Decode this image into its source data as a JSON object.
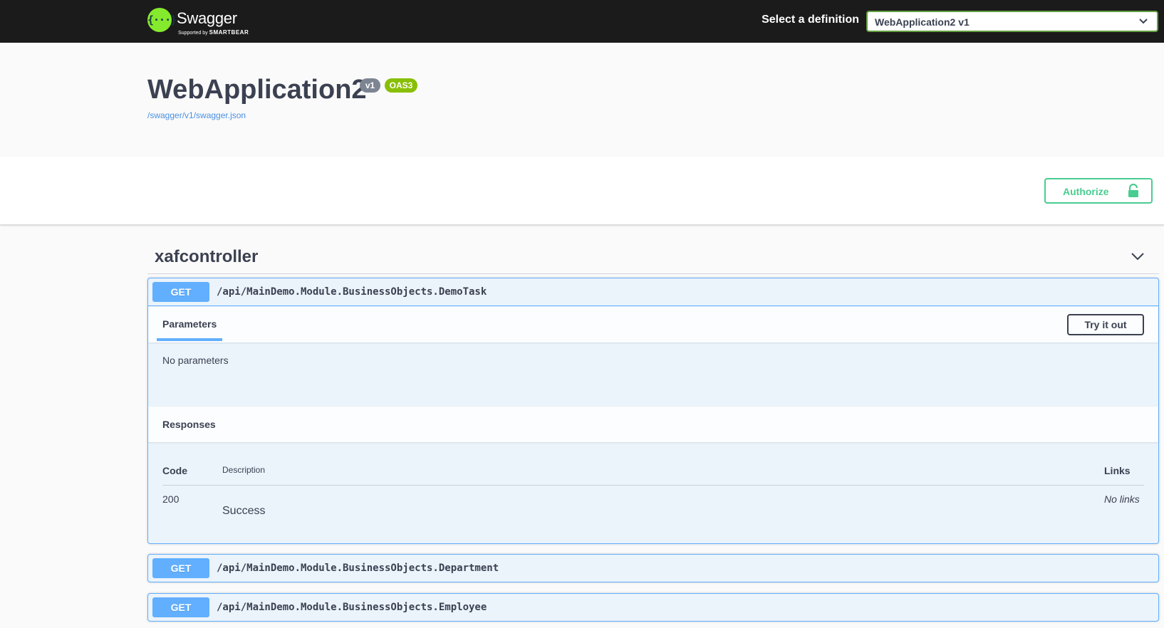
{
  "topbar": {
    "logo_text": "Swagger",
    "logo_tagline_prefix": "Supported by",
    "logo_tagline_brand": "SMARTBEAR",
    "definition_label": "Select a definition",
    "definition_selected": "WebApplication2 v1"
  },
  "info": {
    "title": "WebApplication2",
    "version_badge": "v1",
    "oas_badge": "OAS3",
    "spec_url": "/swagger/v1/swagger.json"
  },
  "scheme": {
    "authorize_label": "Authorize"
  },
  "tag": {
    "name": "xafcontroller"
  },
  "operations": [
    {
      "method": "GET",
      "path": "/api/MainDemo.Module.BusinessObjects.DemoTask",
      "expanded": true,
      "parameters_tab": "Parameters",
      "try_it_out": "Try it out",
      "no_parameters": "No parameters",
      "responses_title": "Responses",
      "columns": {
        "code": "Code",
        "description": "Description",
        "links": "Links"
      },
      "responses": [
        {
          "code": "200",
          "description": "Success",
          "links": "No links"
        }
      ]
    },
    {
      "method": "GET",
      "path": "/api/MainDemo.Module.BusinessObjects.Department",
      "expanded": false
    },
    {
      "method": "GET",
      "path": "/api/MainDemo.Module.BusinessObjects.Employee",
      "expanded": false
    }
  ],
  "colors": {
    "topbar_bg": "#1b1b1b",
    "logo_green": "#85ea2d",
    "get_blue": "#61affe",
    "authorize_green": "#49cc90",
    "oas_badge": "#89bf04",
    "version_badge": "#7d8492"
  },
  "icons": {
    "select_chevron": "chevron-down-icon",
    "authorize_lock": "lock-icon",
    "tag_toggle": "chevron-down-icon"
  }
}
